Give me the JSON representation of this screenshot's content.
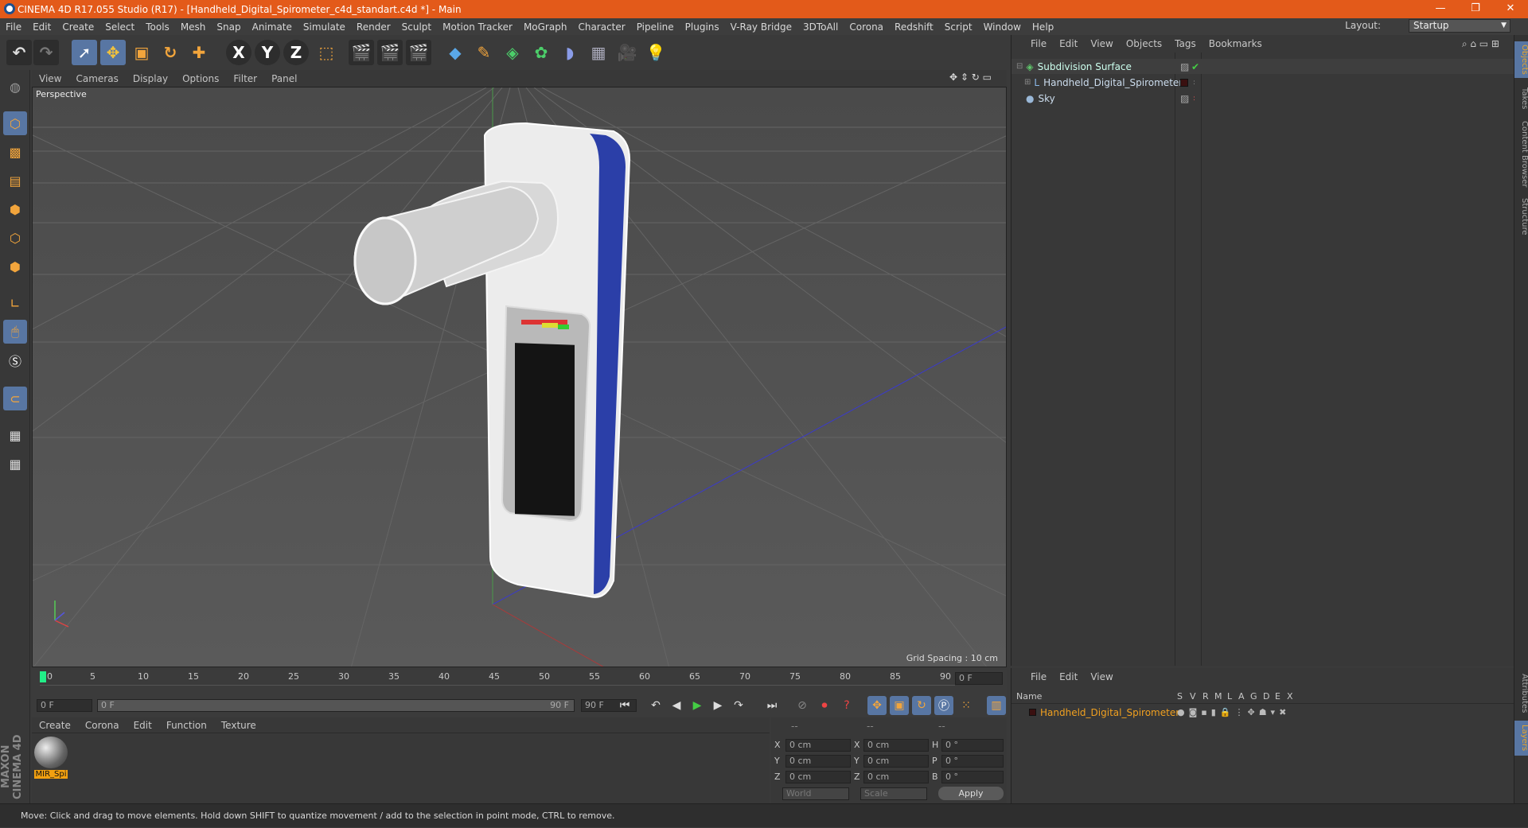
{
  "window": {
    "title": "CINEMA 4D R17.055 Studio (R17) - [Handheld_Digital_Spirometer_c4d_standart.c4d *] - Main",
    "min": "—",
    "max": "❐",
    "close": "✕"
  },
  "menu": [
    "File",
    "Edit",
    "Create",
    "Select",
    "Tools",
    "Mesh",
    "Snap",
    "Animate",
    "Simulate",
    "Render",
    "Sculpt",
    "Motion Tracker",
    "MoGraph",
    "Character",
    "Pipeline",
    "Plugins",
    "V-Ray Bridge",
    "3DToAll",
    "Corona",
    "Redshift",
    "Script",
    "Window",
    "Help"
  ],
  "layout": {
    "label": "Layout:",
    "value": "Startup"
  },
  "toolbar": {
    "undo": "↶",
    "redo": "↷",
    "x": "X",
    "y": "Y",
    "z": "Z"
  },
  "viewport": {
    "menu": [
      "View",
      "Cameras",
      "Display",
      "Options",
      "Filter",
      "Panel"
    ],
    "label": "Perspective",
    "grid_spacing": "Grid Spacing : 10 cm"
  },
  "timeline": {
    "ticks": [
      "0",
      "5",
      "10",
      "15",
      "20",
      "25",
      "30",
      "35",
      "40",
      "45",
      "50",
      "55",
      "60",
      "65",
      "70",
      "75",
      "80",
      "85",
      "90"
    ],
    "current_frame": "0 F",
    "start": "0 F",
    "range_start": "0 F",
    "range_end": "90 F",
    "end": "90 F"
  },
  "materials": {
    "menu": [
      "Create",
      "Corona",
      "Edit",
      "Function",
      "Texture"
    ],
    "items": [
      {
        "name": "MIR_Spi"
      }
    ]
  },
  "coords": {
    "headers": [
      "--",
      "--",
      "--"
    ],
    "rows": [
      {
        "a": "X",
        "av": "0 cm",
        "b": "X",
        "bv": "0 cm",
        "c": "H",
        "cv": "0 °"
      },
      {
        "a": "Y",
        "av": "0 cm",
        "b": "Y",
        "bv": "0 cm",
        "c": "P",
        "cv": "0 °"
      },
      {
        "a": "Z",
        "av": "0 cm",
        "b": "Z",
        "bv": "0 cm",
        "c": "B",
        "cv": "0 °"
      }
    ],
    "mode": "World",
    "size_mode": "Scale",
    "apply": "Apply"
  },
  "objects": {
    "menu": [
      "File",
      "Edit",
      "View",
      "Objects",
      "Tags",
      "Bookmarks"
    ],
    "items": [
      {
        "name": "Subdivision Surface",
        "color": "#5fc66b"
      },
      {
        "name": "Handheld_Digital_Spirometer",
        "color": "#8ab8e8"
      },
      {
        "name": "Sky",
        "color": "#9ab8d8"
      }
    ]
  },
  "layers": {
    "menu": [
      "File",
      "Edit",
      "View"
    ],
    "columns": {
      "name": "Name",
      "flags": [
        "S",
        "V",
        "R",
        "M",
        "L",
        "A",
        "G",
        "D",
        "E",
        "X"
      ]
    },
    "items": [
      {
        "name": "Handheld_Digital_Spirometer",
        "color": "#f0a020"
      }
    ]
  },
  "side_tabs": [
    "Objects",
    "Takes",
    "Content Browser",
    "Structure",
    "Attributes",
    "Layers"
  ],
  "branding": "MAXON CINEMA 4D",
  "status": "Move: Click and drag to move elements. Hold down SHIFT to quantize movement / add to the selection in point mode, CTRL to remove."
}
